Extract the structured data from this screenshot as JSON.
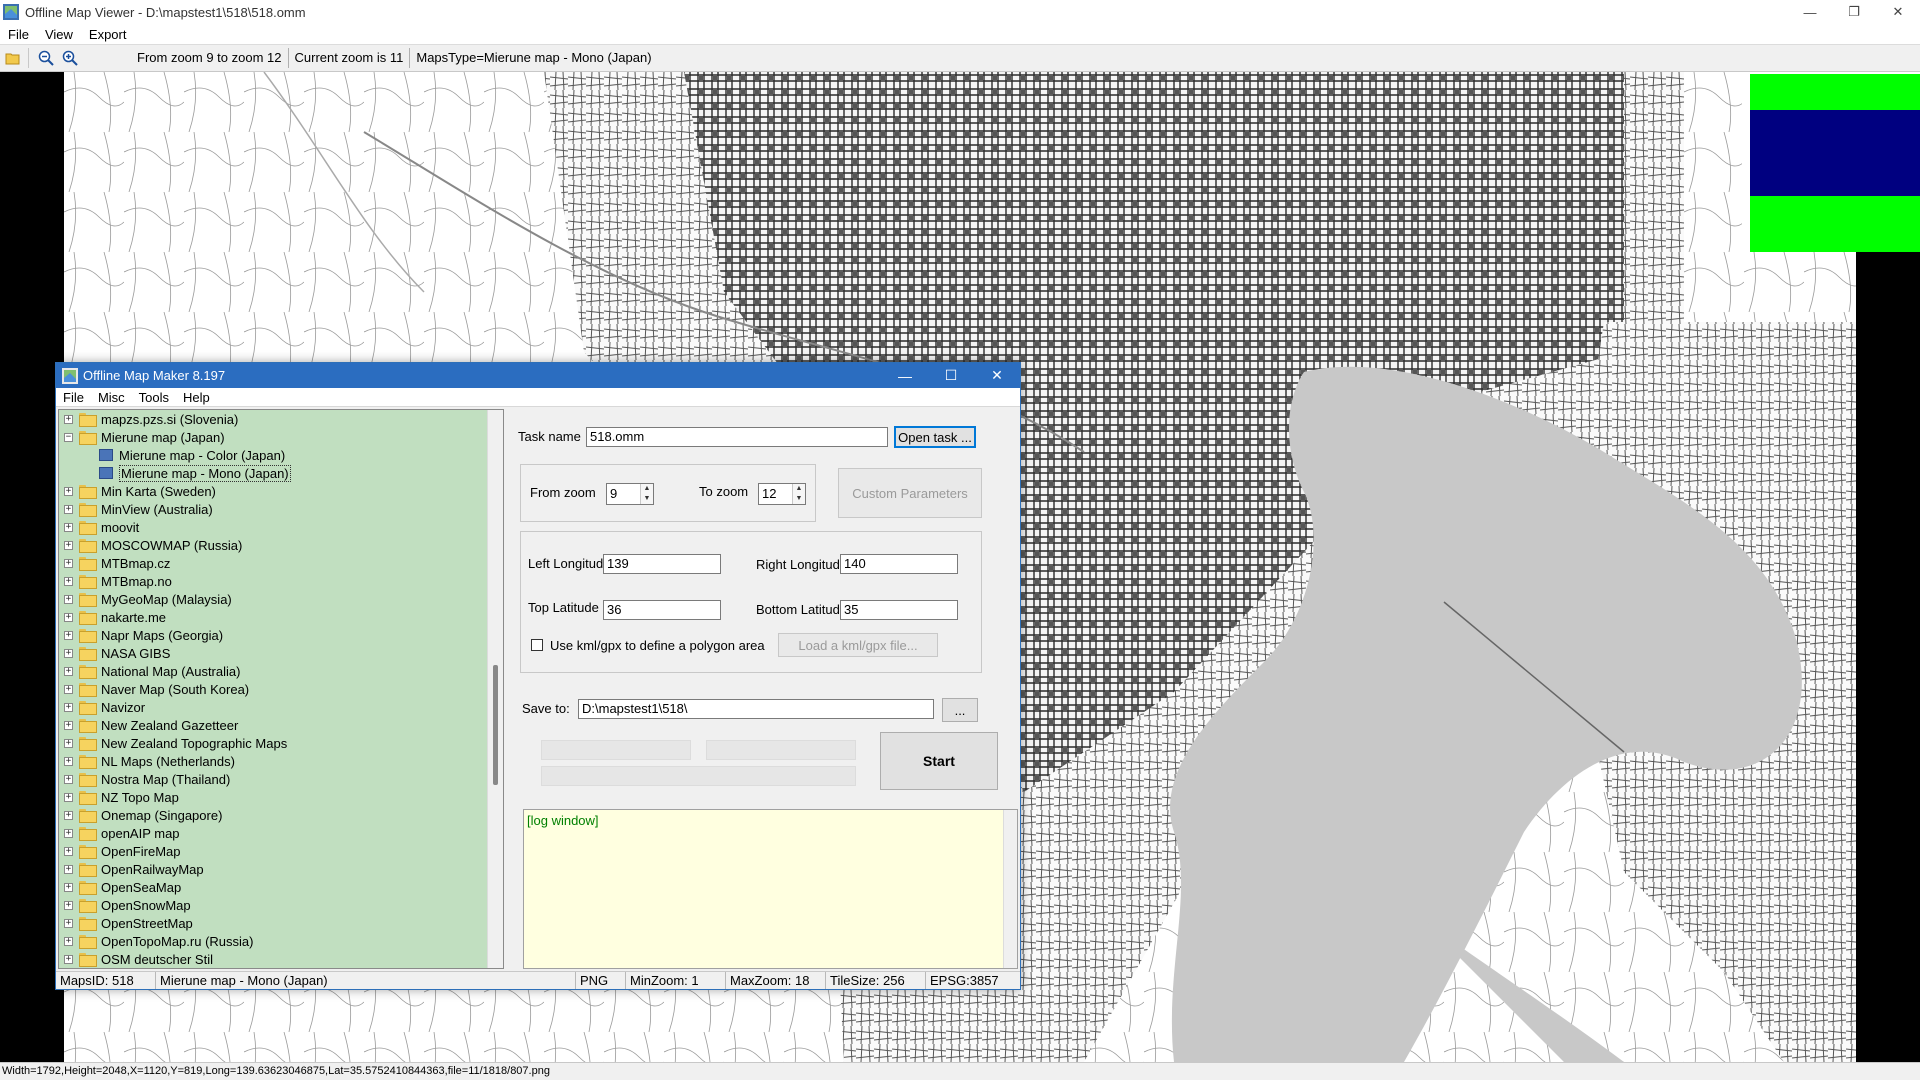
{
  "viewer": {
    "title": "Offline Map Viewer - D:\\mapstest1\\518\\518.omm",
    "window_buttons": [
      "—",
      "❐",
      "✕"
    ],
    "menu": [
      "File",
      "View",
      "Export"
    ],
    "toolbar": {
      "icons": [
        "open-folder-icon",
        "zoom-out-icon",
        "zoom-in-icon"
      ],
      "zoom_range": "From zoom 9 to zoom 12",
      "current_zoom": "Current zoom is 11",
      "maps_type": "MapsType=Mierune map - Mono (Japan)"
    },
    "status": "Width=1792,Height=2048,X=1120,Y=819,Long=139.63623046875,Lat=35.5752410844363,file=11/1818/807.png",
    "overview_colors": [
      "#00ff00",
      "#000080",
      "#00ff00"
    ]
  },
  "dialog": {
    "title": "Offline Map Maker 8.197",
    "window_buttons": [
      "—",
      "☐",
      "✕"
    ],
    "menu": [
      "File",
      "Misc",
      "Tools",
      "Help"
    ],
    "tree": [
      {
        "label": "mapzs.pzs.si (Slovenia)",
        "expand": "+"
      },
      {
        "label": "Mierune map (Japan)",
        "expand": "−",
        "open": true
      },
      {
        "label": "Mierune map - Color (Japan)",
        "child": true
      },
      {
        "label": "Mierune map - Mono (Japan)",
        "child": true,
        "selected": true
      },
      {
        "label": "Min Karta (Sweden)",
        "expand": "+"
      },
      {
        "label": "MinView (Australia)",
        "expand": "+"
      },
      {
        "label": "moovit",
        "expand": "+"
      },
      {
        "label": "MOSCOWMAP (Russia)",
        "expand": "+"
      },
      {
        "label": "MTBmap.cz",
        "expand": "+"
      },
      {
        "label": "MTBmap.no",
        "expand": "+"
      },
      {
        "label": "MyGeoMap (Malaysia)",
        "expand": "+"
      },
      {
        "label": "nakarte.me",
        "expand": "+"
      },
      {
        "label": "Napr Maps (Georgia)",
        "expand": "+"
      },
      {
        "label": "NASA GIBS",
        "expand": "+"
      },
      {
        "label": "National Map (Australia)",
        "expand": "+"
      },
      {
        "label": "Naver Map (South Korea)",
        "expand": "+"
      },
      {
        "label": "Navizor",
        "expand": "+"
      },
      {
        "label": "New Zealand Gazetteer",
        "expand": "+"
      },
      {
        "label": "New Zealand Topographic Maps",
        "expand": "+"
      },
      {
        "label": "NL Maps (Netherlands)",
        "expand": "+"
      },
      {
        "label": "Nostra Map (Thailand)",
        "expand": "+"
      },
      {
        "label": "NZ Topo Map",
        "expand": "+"
      },
      {
        "label": "Onemap (Singapore)",
        "expand": "+"
      },
      {
        "label": "openAIP map",
        "expand": "+"
      },
      {
        "label": "OpenFireMap",
        "expand": "+"
      },
      {
        "label": "OpenRailwayMap",
        "expand": "+"
      },
      {
        "label": "OpenSeaMap",
        "expand": "+"
      },
      {
        "label": "OpenSnowMap",
        "expand": "+"
      },
      {
        "label": "OpenStreetMap",
        "expand": "+"
      },
      {
        "label": "OpenTopoMap.ru (Russia)",
        "expand": "+"
      },
      {
        "label": "OSM deutscher Stil",
        "expand": "+"
      }
    ],
    "task_name_label": "Task name",
    "task_name_value": "518.omm",
    "open_task_button": "Open task ...",
    "from_zoom_label": "From zoom",
    "from_zoom_value": "9",
    "to_zoom_label": "To zoom",
    "to_zoom_value": "12",
    "custom_params_button": "Custom Parameters",
    "left_lon_label": "Left Longitude",
    "left_lon_value": "139",
    "right_lon_label": "Right Longitude",
    "right_lon_value": "140",
    "top_lat_label": "Top Latitude",
    "top_lat_value": "36",
    "bottom_lat_label": "Bottom Latitude",
    "bottom_lat_value": "35",
    "kml_checkbox_label": "Use kml/gpx to define a polygon area",
    "load_kml_button": "Load a kml/gpx file...",
    "save_to_label": "Save to:",
    "save_to_value": "D:\\mapstest1\\518\\",
    "browse_button": "...",
    "start_button": "Start",
    "log_text": "[log window]",
    "status": {
      "maps_id": "MapsID: 518",
      "map_name": "Mierune map - Mono (Japan)",
      "format": "PNG",
      "min_zoom": "MinZoom: 1",
      "max_zoom": "MaxZoom: 18",
      "tile_size": "TileSize: 256",
      "epsg": "EPSG:3857"
    }
  }
}
